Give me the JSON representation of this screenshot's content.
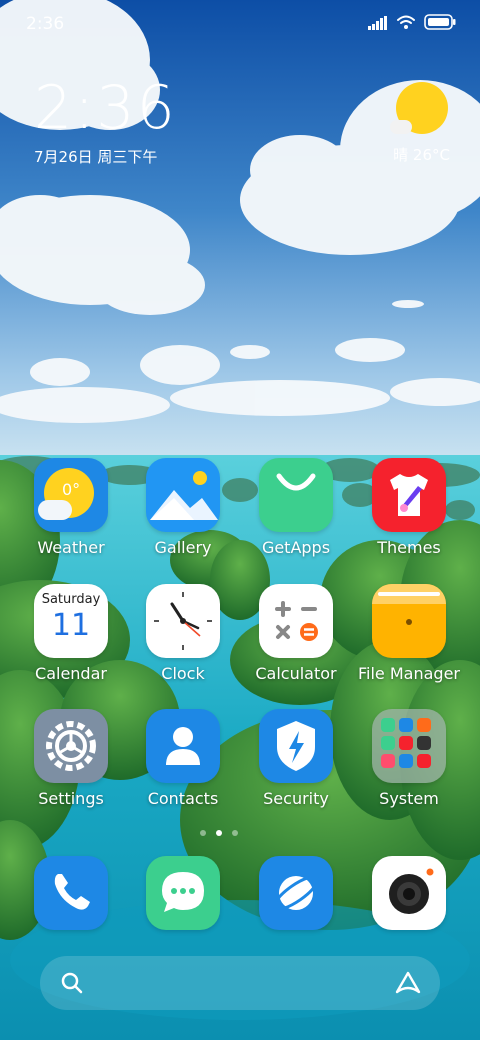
{
  "status_bar": {
    "time": "2:36",
    "icons": [
      "signal-icon",
      "wifi-icon",
      "battery-icon"
    ]
  },
  "clock_widget": {
    "time": "2:36",
    "date": "7月26日 周三下午"
  },
  "weather_widget": {
    "condition_icon": "sun-cloud-icon",
    "text": "晴 26°C"
  },
  "apps": [
    {
      "id": "weather",
      "label": "Weather",
      "icon_text": "0°",
      "color": "#1e88e5"
    },
    {
      "id": "gallery",
      "label": "Gallery",
      "color": "#2196f3"
    },
    {
      "id": "getapps",
      "label": "GetApps",
      "color": "#3ccf8e"
    },
    {
      "id": "themes",
      "label": "Themes",
      "color": "#f5222d"
    },
    {
      "id": "calendar",
      "label": "Calendar",
      "icon_day": "Saturday",
      "icon_date": "11",
      "color": "#ffffff"
    },
    {
      "id": "clock",
      "label": "Clock",
      "color": "#ffffff"
    },
    {
      "id": "calculator",
      "label": "Calculator",
      "color": "#ffffff"
    },
    {
      "id": "file-manager",
      "label": "File Manager",
      "color": "#ffb300"
    },
    {
      "id": "settings",
      "label": "Settings",
      "color": "#7d8fa3"
    },
    {
      "id": "contacts",
      "label": "Contacts",
      "color": "#1e88e5"
    },
    {
      "id": "security",
      "label": "Security",
      "color": "#1e88e5"
    },
    {
      "id": "system",
      "label": "System",
      "color": "#9aa8a0"
    }
  ],
  "page_indicator": {
    "pages": 3,
    "current": 2
  },
  "dock": [
    {
      "id": "phone",
      "icon": "phone-icon",
      "color": "#1e88e5"
    },
    {
      "id": "messages",
      "icon": "chat-bubble-icon",
      "color": "#3ccf8e"
    },
    {
      "id": "browser",
      "icon": "planet-icon",
      "color": "#1e88e5"
    },
    {
      "id": "camera",
      "icon": "camera-icon",
      "color": "#ffffff"
    }
  ],
  "search_bar": {
    "left_icon": "search-icon",
    "right_icon": "assistant-icon"
  }
}
